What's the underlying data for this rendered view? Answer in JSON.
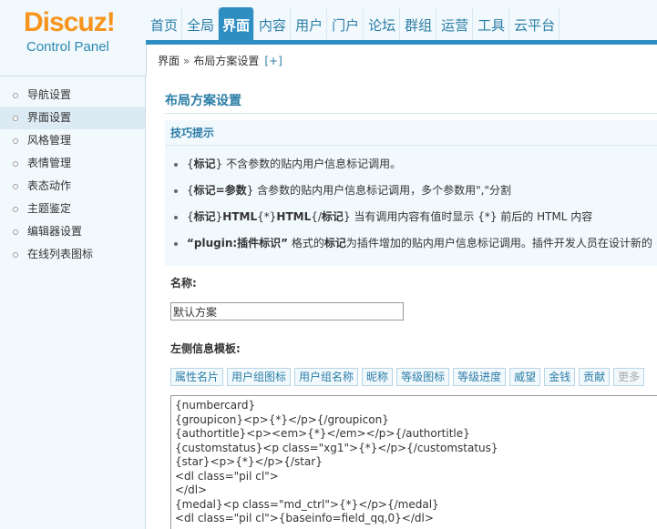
{
  "logo": {
    "word": "Discuz!",
    "sub": "Control Panel"
  },
  "nav": {
    "items": [
      "首页",
      "全局",
      "界面",
      "内容",
      "用户",
      "门户",
      "论坛",
      "群组",
      "运营",
      "工具",
      "云平台"
    ],
    "active": "界面"
  },
  "breadcrumb": {
    "section": "界面",
    "separator": "»",
    "page": "布局方案设置",
    "add": "[+]"
  },
  "sidebar": {
    "items": [
      "导航设置",
      "界面设置",
      "风格管理",
      "表情管理",
      "表态动作",
      "主题鉴定",
      "编辑器设置",
      "在线列表图标"
    ],
    "active": "界面设置"
  },
  "main": {
    "title": "布局方案设置",
    "tips": {
      "header": "技巧提示",
      "lines": [
        [
          "{",
          "标记",
          "} 不含参数的贴内用户信息标记调用。"
        ],
        [
          "{",
          "标记=参数",
          "} 含参数的贴内用户信息标记调用，多个参数用\",\"分割"
        ],
        [
          "{",
          "标记",
          "}",
          "HTML",
          "{*}",
          "HTML",
          "{/",
          "标记",
          "} 当有调用内容有值时显示 {*} 前后的 HTML 内容"
        ],
        [
          "“plugin:插件标识”",
          " 格式的",
          "标记",
          "为插件增加的贴内用户信息标记调用。插件开发人员在设计新的"
        ]
      ]
    },
    "name_label": "名称:",
    "name_value": "默认方案",
    "left_template_label": "左侧信息模板:",
    "tag_buttons": [
      "属性名片",
      "用户组图标",
      "用户组名称",
      "昵称",
      "等级图标",
      "等级进度",
      "威望",
      "金钱",
      "贡献",
      "更多"
    ],
    "template_text": "{numbercard}\n{groupicon}<p>{*}</p>{/groupicon}\n{authortitle}<p><em>{*}</em></p>{/authortitle}\n{customstatus}<p class=\"xg1\">{*}</p>{/customstatus}\n{star}<p>{*}</p>{/star}\n<dl class=\"pil cl\">\n</dl>\n{medal}<p class=\"md_ctrl\">{*}</p>{/medal}\n<dl class=\"pil cl\">{baseinfo=field_qq,0}</dl>"
  }
}
